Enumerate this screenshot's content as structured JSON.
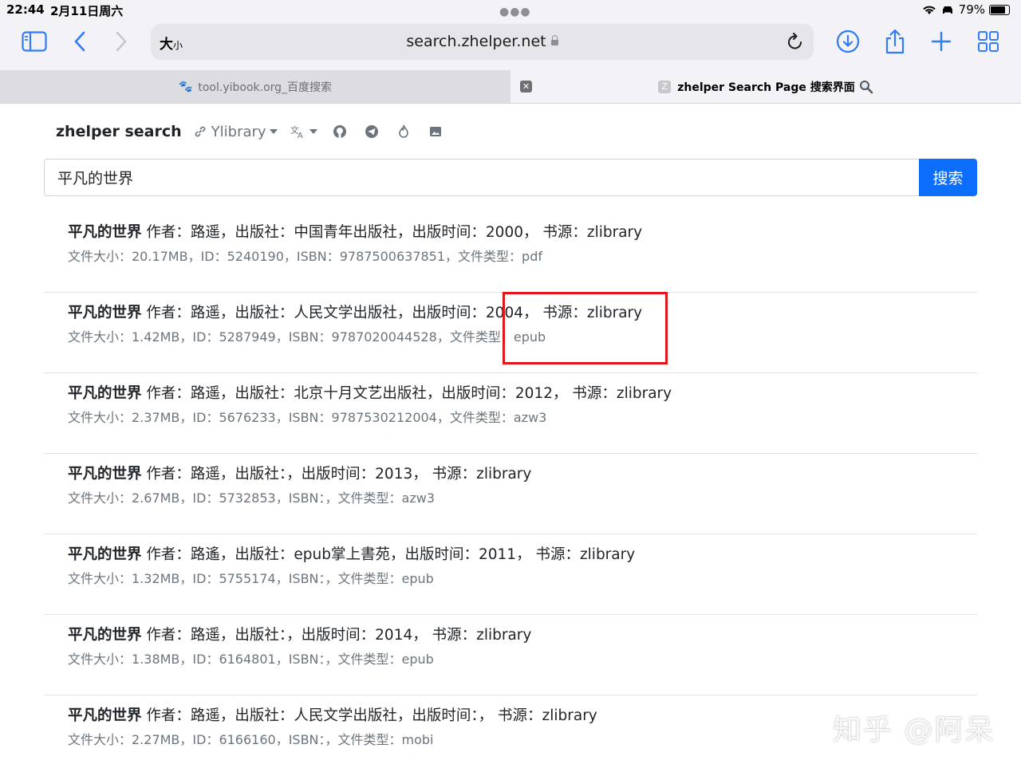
{
  "status_bar": {
    "time": "22:44",
    "date": "2月11日周六",
    "battery": "79%"
  },
  "toolbar": {
    "text_size": "大",
    "text_size_small": "小",
    "url": "search.zhelper.net"
  },
  "tabs": [
    {
      "label": "tool.yibook.org_百度搜索"
    },
    {
      "label": "zhelper Search Page 搜索界面",
      "favicon": "Z"
    }
  ],
  "nav": {
    "brand": "zhelper search",
    "library": "Ylibrary"
  },
  "search": {
    "value": "平凡的世界",
    "button": "搜索"
  },
  "results": [
    {
      "title": "平凡的世界",
      "info": " 作者：路遥，出版社：中国青年出版社，出版时间：2000， 书源：zlibrary",
      "meta": "文件大小：20.17MB，ID：5240190，ISBN：9787500637851，文件类型：pdf"
    },
    {
      "title": "平凡的世界",
      "info": " 作者：路遥，出版社：人民文学出版社，出版时间：2004， 书源：zlibrary",
      "meta": "文件大小：1.42MB，ID：5287949，ISBN：9787020044528，文件类型：epub"
    },
    {
      "title": "平凡的世界",
      "info": " 作者：路遥，出版社：北京十月文艺出版社，出版时间：2012， 书源：zlibrary",
      "meta": "文件大小：2.37MB，ID：5676233，ISBN：9787530212004，文件类型：azw3"
    },
    {
      "title": "平凡的世界",
      "info": " 作者：路遥，出版社：，出版时间：2013， 书源：zlibrary",
      "meta": "文件大小：2.67MB，ID：5732853，ISBN：，文件类型：azw3"
    },
    {
      "title": "平凡的世界",
      "info": " 作者：路遙，出版社：epub掌上書苑，出版时间：2011， 书源：zlibrary",
      "meta": "文件大小：1.32MB，ID：5755174，ISBN：，文件类型：epub"
    },
    {
      "title": "平凡的世界",
      "info": " 作者：路遥，出版社：，出版时间：2014， 书源：zlibrary",
      "meta": "文件大小：1.38MB，ID：6164801，ISBN：，文件类型：epub"
    },
    {
      "title": "平凡的世界",
      "info": " 作者：路遥，出版社：人民文学出版社，出版时间：， 书源：zlibrary",
      "meta": "文件大小：2.27MB，ID：6166160，ISBN：，文件类型：mobi"
    }
  ],
  "watermark": "知乎 @阿呆",
  "colors": {
    "accent": "#0d6efd",
    "highlight": "#e0161b",
    "safari_blue": "#2f7cf6"
  }
}
